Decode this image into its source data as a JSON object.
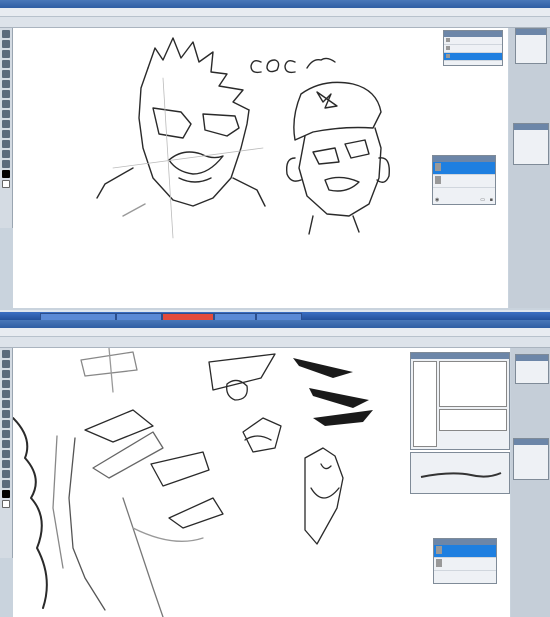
{
  "top_window": {
    "title": "",
    "brand": "",
    "menus": [
      "",
      "",
      "",
      "",
      "",
      "",
      "",
      "",
      ""
    ],
    "sketch_text": "coc",
    "layers": [
      "",
      "",
      ""
    ],
    "layers2": [
      "",
      ""
    ]
  },
  "bottom_window": {
    "title": "",
    "brand": "",
    "menus": [
      "",
      "",
      "",
      "",
      "",
      "",
      "",
      "",
      ""
    ],
    "taskbar_items": [
      "",
      "",
      "",
      "",
      ""
    ]
  },
  "colors": {
    "canvas": "#ffffff",
    "chrome": "#c9d3dd",
    "selected_layer": "#1e7fe0",
    "taskbar": "#2f5ea3",
    "stroke": "#2a2a2a"
  },
  "icons": [
    "brush-tool-icon",
    "eraser-tool-icon",
    "move-tool-icon",
    "lasso-tool-icon",
    "zoom-tool-icon",
    "eye-icon",
    "folder-icon",
    "trash-icon"
  ]
}
